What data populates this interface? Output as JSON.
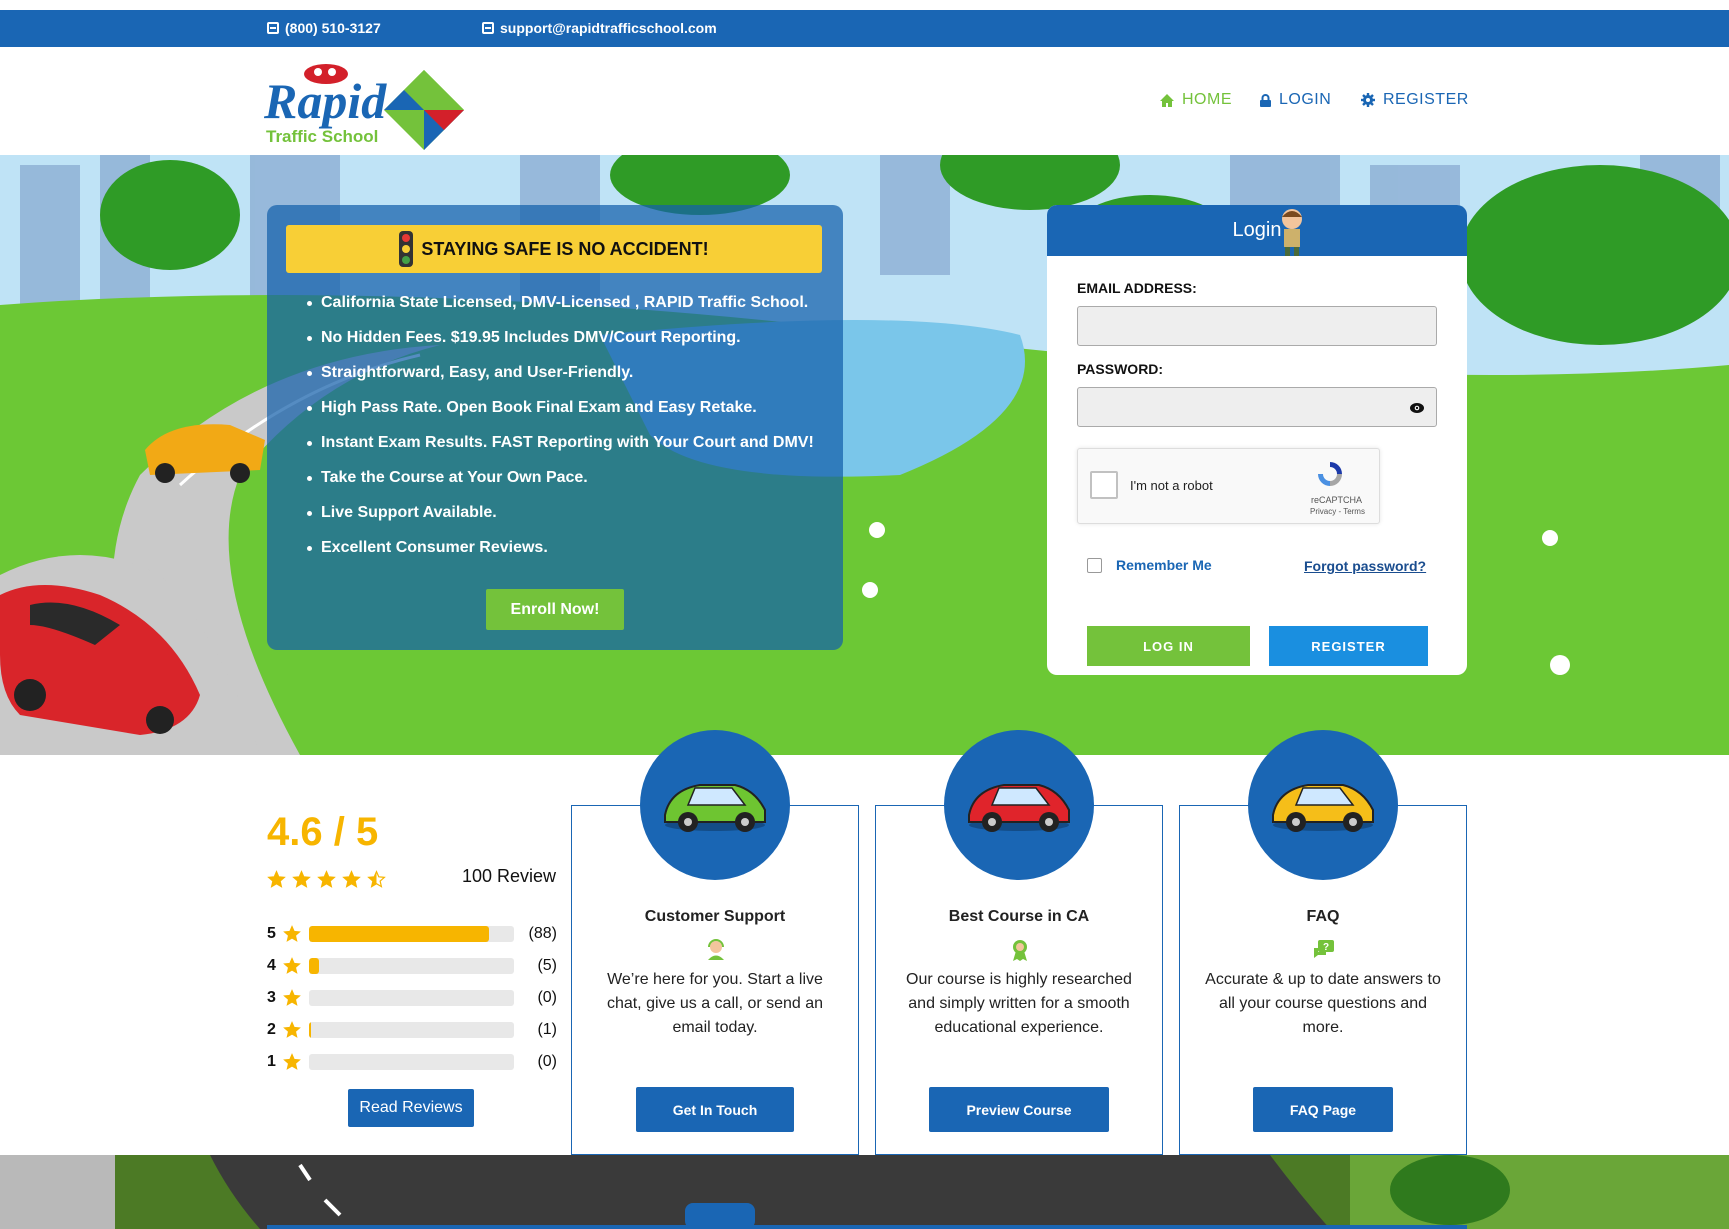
{
  "topbar": {
    "phone": "(800) 510-3127",
    "email": "support@rapidtrafficschool.com"
  },
  "logo": {
    "word1": "Rapid",
    "word2": "Traffic School"
  },
  "nav": [
    {
      "label": "HOME",
      "icon": "home-icon",
      "color": "#74c23b"
    },
    {
      "label": "LOGIN",
      "icon": "lock-icon",
      "color": "#1a66b4"
    },
    {
      "label": "REGISTER",
      "icon": "gear-icon",
      "color": "#1a66b4"
    }
  ],
  "hero": {
    "banner": "STAYING SAFE IS NO ACCIDENT!",
    "bullets": [
      "California State Licensed, DMV-Licensed , RAPID Traffic School.",
      "No Hidden Fees. $19.95 Includes DMV/Court Reporting.",
      "Straightforward, Easy, and User-Friendly.",
      "High Pass Rate. Open Book Final Exam and Easy Retake.",
      "Instant Exam Results. FAST Reporting with Your Court and DMV!",
      "Take the Course at Your Own Pace.",
      "Live Support Available.",
      "Excellent Consumer Reviews."
    ],
    "enroll_label": "Enroll Now!"
  },
  "login": {
    "title": "Login",
    "email_label": "EMAIL ADDRESS:",
    "email_value": "",
    "password_label": "PASSWORD:",
    "password_value": "",
    "captcha_label": "I'm not a robot",
    "captcha_brand": "reCAPTCHA",
    "captcha_links": "Privacy - Terms",
    "remember_label": "Remember Me",
    "forgot_label": "Forgot password?",
    "login_button": "LOG IN",
    "register_button": "REGISTER"
  },
  "rating": {
    "score": "4.6 / 5",
    "review_count": "100 Review",
    "star_value": 4.5,
    "breakdown": [
      {
        "stars": "5",
        "count": "(88)",
        "fraction": 0.88
      },
      {
        "stars": "4",
        "count": "(5)",
        "fraction": 0.05
      },
      {
        "stars": "3",
        "count": "(0)",
        "fraction": 0
      },
      {
        "stars": "2",
        "count": "(1)",
        "fraction": 0.01
      },
      {
        "stars": "1",
        "count": "(0)",
        "fraction": 0
      }
    ],
    "read_reviews": "Read Reviews"
  },
  "cards": [
    {
      "title": "Customer Support",
      "icon": "support-agent-icon",
      "text": "We’re here for you. Start a live chat, give us a call, or send an email today.",
      "button": "Get In Touch",
      "car_color": "#6ec531"
    },
    {
      "title": "Best Course in CA",
      "icon": "award-ribbon-icon",
      "text": "Our course is highly researched and simply written for a smooth educational experience.",
      "button": "Preview Course",
      "car_color": "#e0242b"
    },
    {
      "title": "FAQ",
      "icon": "question-chat-icon",
      "text": "Accurate & up to date answers to all your course questions and more.",
      "button": "FAQ Page",
      "car_color": "#f5be19"
    }
  ],
  "colors": {
    "brand_blue": "#1a66b4",
    "accent_green": "#74c23b",
    "star_gold": "#f7b500",
    "banner_yellow": "#f8cf36",
    "register_blue": "#1a8fe0"
  }
}
